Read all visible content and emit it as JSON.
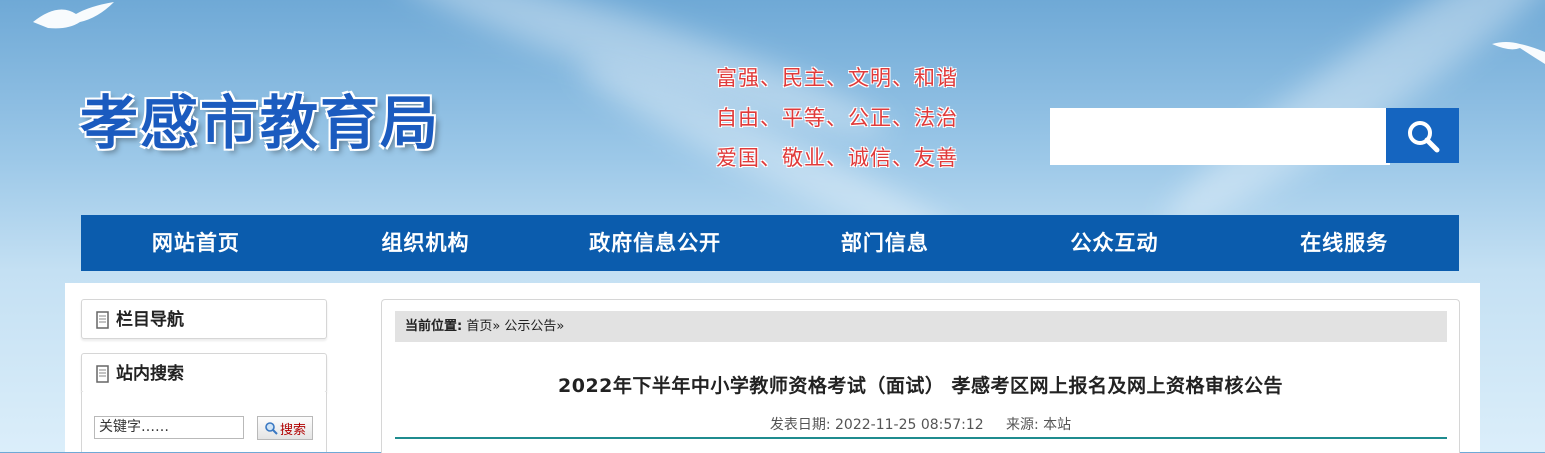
{
  "header": {
    "site_title": "孝感市教育局",
    "core_values": [
      "富强、民主、文明、和谐",
      "自由、平等、公正、法治",
      "爱国、敬业、诚信、友善"
    ],
    "search_placeholder": "",
    "search_icon": "search-icon"
  },
  "nav": {
    "items": [
      "网站首页",
      "组织机构",
      "政府信息公开",
      "部门信息",
      "公众互动",
      "在线服务"
    ]
  },
  "sidebar": {
    "column_nav_title": "栏目导航",
    "site_search_title": "站内搜索",
    "keyword_value": "关键字……",
    "search_button": "搜索"
  },
  "breadcrumb": {
    "label": "当前位置:",
    "path": "首页» 公示公告»"
  },
  "article": {
    "title": "2022年下半年中小学教师资格考试（面试） 孝感考区网上报名及网上资格审核公告",
    "date_label": "发表日期:",
    "date": "2022-11-25 08:57:12",
    "source_label": "来源:",
    "source": "本站"
  },
  "colors": {
    "nav_bg": "#0b5cad",
    "title_blue": "#1b5bbf",
    "values_red": "#e03a3a",
    "rule": "#1f8c8f"
  }
}
